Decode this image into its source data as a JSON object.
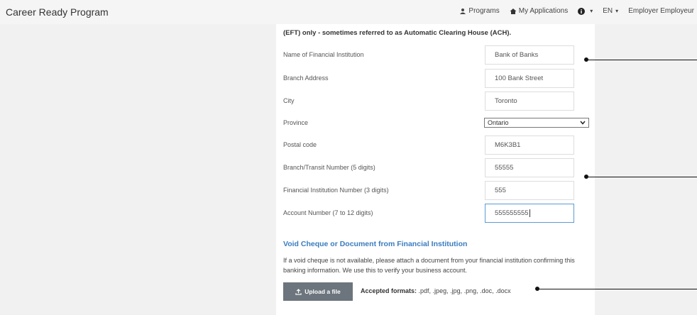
{
  "header": {
    "brand": "Career Ready Program",
    "nav": {
      "programs": "Programs",
      "applications": "My Applications",
      "language": "EN",
      "user": "Employer Employeur"
    }
  },
  "form": {
    "intro": "(EFT) only - sometimes referred to as Automatic Clearing House (ACH).",
    "fields": [
      {
        "label": "Name of Financial Institution",
        "value": "Bank of Banks"
      },
      {
        "label": "Branch Address",
        "value": "100 Bank Street"
      },
      {
        "label": "City",
        "value": "Toronto"
      },
      {
        "label": "Province",
        "value": "Ontario"
      },
      {
        "label": "Postal code",
        "value": "M6K3B1"
      },
      {
        "label": "Branch/Transit Number (5 digits)",
        "value": "55555"
      },
      {
        "label": "Financial Institution Number (3 digits)",
        "value": "555"
      },
      {
        "label": "Account Number (7 to 12 digits)",
        "value": "555555555"
      }
    ]
  },
  "upload_section": {
    "title": "Void Cheque or Document from Financial Institution",
    "help": "If a void cheque is not available, please attach a document from your financial institution confirming this banking information. We use this to verify your business account.",
    "button_label": "Upload a file",
    "formats_label": "Accepted formats:",
    "formats_value": ".pdf, .jpeg, .jpg, .png, .doc, .docx"
  },
  "colors": {
    "accent": "#3a7dbf",
    "button": "#6c757d",
    "background": "#f1f1f1"
  }
}
